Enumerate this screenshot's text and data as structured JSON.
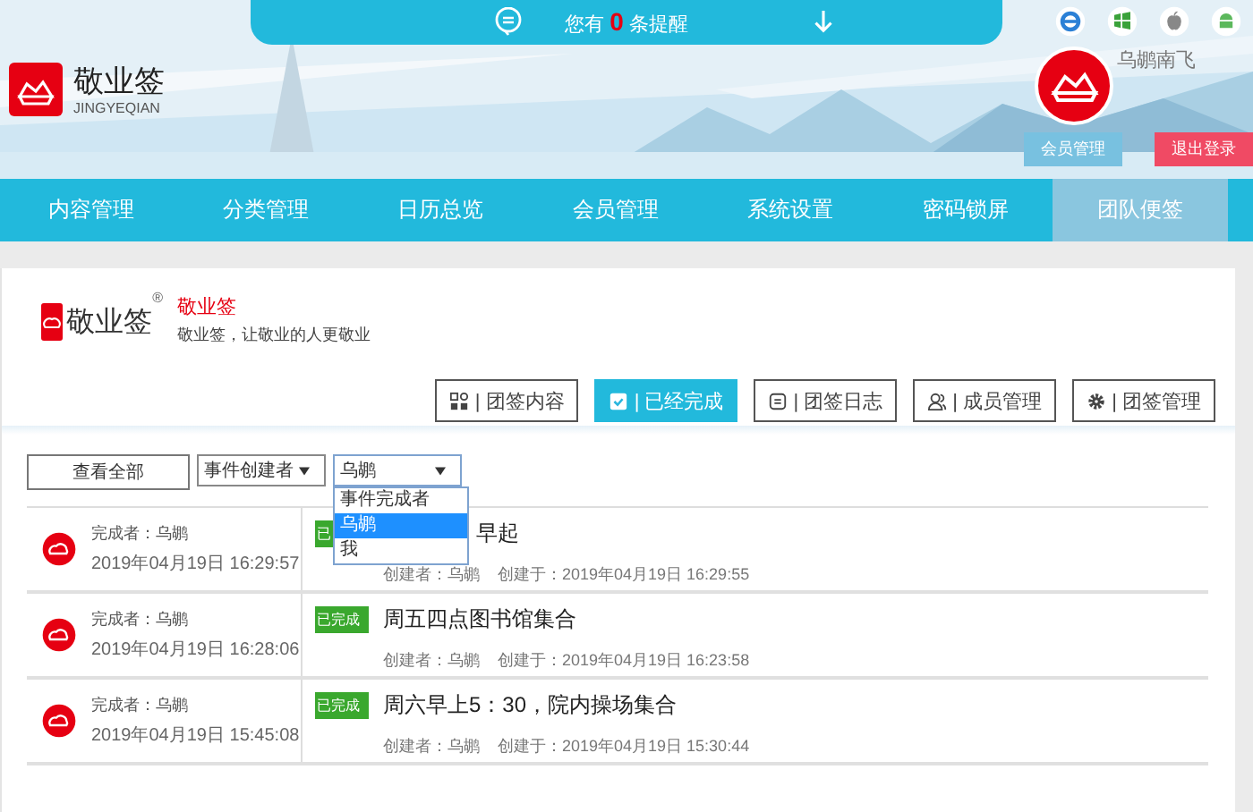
{
  "notification": {
    "prefix": "您有",
    "count": "0",
    "suffix": "条提醒"
  },
  "brand": {
    "name": "敬业签",
    "subtitle": "JINGYEQIAN"
  },
  "user": {
    "name": "乌鹕南飞",
    "buttons": [
      {
        "label": "会员管理",
        "kind": "primary"
      },
      {
        "label": "退出登录",
        "kind": "danger"
      }
    ]
  },
  "nav": [
    {
      "label": "内容管理",
      "selected": false
    },
    {
      "label": "分类管理",
      "selected": false
    },
    {
      "label": "日历总览",
      "selected": false
    },
    {
      "label": "会员管理",
      "selected": false
    },
    {
      "label": "系统设置",
      "selected": false
    },
    {
      "label": "密码锁屏",
      "selected": false
    },
    {
      "label": "团队便签",
      "selected": true
    }
  ],
  "team": {
    "logo_text": "敬业签",
    "registered": "®",
    "title": "敬业签",
    "slogan": "敬业签，让敬业的人更敬业"
  },
  "actions": [
    {
      "label": "| 团签内容",
      "kind": "grid",
      "selected": false
    },
    {
      "label": "| 已经完成",
      "kind": "check",
      "selected": true
    },
    {
      "label": "| 团签日志",
      "kind": "log",
      "selected": false
    },
    {
      "label": "| 成员管理",
      "kind": "people",
      "selected": false
    },
    {
      "label": "| 团签管理",
      "kind": "gear",
      "selected": false
    }
  ],
  "filters": {
    "all_button": "查看全部",
    "selects": [
      {
        "value": "事件创建者",
        "open": false
      },
      {
        "value": "乌鹕",
        "open": true,
        "options": [
          {
            "label": "事件完成者",
            "selected": false
          },
          {
            "label": "乌鹕",
            "selected": true
          },
          {
            "label": "我",
            "selected": false
          }
        ]
      }
    ]
  },
  "entries": [
    {
      "completer": "完成者：乌鹕",
      "completed_at": "2019年04月19日 16:29:57",
      "badge": "已",
      "title": "早起",
      "creator": "创建者：乌鹕",
      "created_at": "创建于：2019年04月19日 16:29:55"
    },
    {
      "completer": "完成者：乌鹕",
      "completed_at": "2019年04月19日 16:28:06",
      "badge": "已完成",
      "title": "周五四点图书馆集合",
      "creator": "创建者：乌鹕",
      "created_at": "创建于：2019年04月19日 16:23:58"
    },
    {
      "completer": "完成者：乌鹕",
      "completed_at": "2019年04月19日 15:45:08",
      "badge": "已完成",
      "title": "周六早上5：30，院内操场集合",
      "creator": "创建者：乌鹕",
      "created_at": "创建于：2019年04月19日 15:30:44"
    }
  ]
}
